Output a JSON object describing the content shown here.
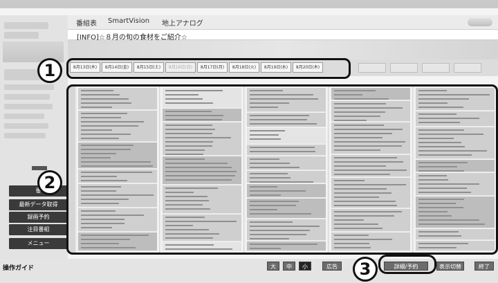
{
  "topnav": {
    "tabs": [
      {
        "label": "番組表"
      },
      {
        "label": "SmartVision"
      },
      {
        "label": "地上アナログ"
      }
    ]
  },
  "info": {
    "text": "[INFO]☆８月の旬の食材をご紹介☆"
  },
  "dates": [
    {
      "label": "8月13日(木)"
    },
    {
      "label": "8月14日(金)"
    },
    {
      "label": "8月15日(土)"
    },
    {
      "label": "8月16日(日)"
    },
    {
      "label": "8月17日(月)"
    },
    {
      "label": "8月18日(火)"
    },
    {
      "label": "8月19日(水)"
    },
    {
      "label": "8月20日(木)"
    }
  ],
  "sidebar": {
    "buttons": [
      {
        "label": "番"
      },
      {
        "label": "最新データ取得"
      },
      {
        "label": "録画予約"
      },
      {
        "label": "注目番組"
      },
      {
        "label": "メニュー"
      }
    ]
  },
  "status": {
    "label": "操作ガイド",
    "size_large": "大",
    "size_medium": "中",
    "size_small": "小",
    "ad": "広告",
    "detail": "詳細/予約",
    "display_switch": "表示切替",
    "exit": "終了"
  },
  "callouts": {
    "one": "1",
    "two": "2",
    "three": "3"
  }
}
